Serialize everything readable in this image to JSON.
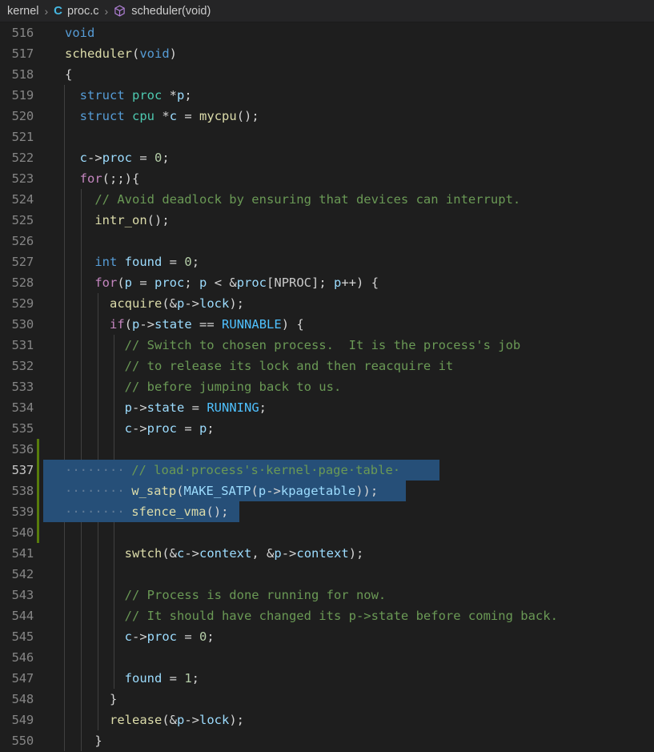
{
  "breadcrumb": {
    "name": "breadcrumb",
    "folder": "kernel",
    "separator": "›",
    "file": "proc.c",
    "file_icon_letter": "C",
    "file_icon_color": "#45b6e0",
    "symbol": "scheduler(void)",
    "symbol_icon": "cube-icon",
    "symbol_icon_color": "#b180d7"
  },
  "editor": {
    "language": "c",
    "first_line": 516,
    "active_line": 537,
    "theme": {
      "background": "#1e1e1e",
      "breadcrumb_background": "#252526",
      "selection": "#264f78",
      "gutter_added": "#587c0c",
      "line_number": "#858585",
      "line_number_active": "#c6c6c6",
      "indent_guide": "#404040",
      "keyword": "#c586c0",
      "type": "#569cd6",
      "typename": "#4ec9b0",
      "function": "#dcdcaa",
      "variable": "#9cdcfe",
      "constant": "#4fc1ff",
      "macro": "#c8c8c8",
      "number": "#b5cea8",
      "comment": "#6a9955",
      "plain": "#d4d4d4"
    },
    "lines": [
      {
        "n": 516,
        "text": "void",
        "indent": 0,
        "guides": 0,
        "changed": false,
        "selected": false,
        "tokens": [
          {
            "t": "void",
            "c": "t-type"
          }
        ]
      },
      {
        "n": 517,
        "text": "scheduler(void)",
        "indent": 0,
        "guides": 0,
        "changed": false,
        "selected": false,
        "tokens": [
          {
            "t": "scheduler",
            "c": "t-func"
          },
          {
            "t": "(",
            "c": "t-plain"
          },
          {
            "t": "void",
            "c": "t-type"
          },
          {
            "t": ")",
            "c": "t-plain"
          }
        ]
      },
      {
        "n": 518,
        "text": "{",
        "indent": 0,
        "guides": 0,
        "changed": false,
        "selected": false,
        "tokens": [
          {
            "t": "{",
            "c": "t-plain"
          }
        ]
      },
      {
        "n": 519,
        "text": "  struct proc *p;",
        "indent": 2,
        "guides": 1,
        "changed": false,
        "selected": false,
        "tokens": [
          {
            "t": "  ",
            "c": "t-plain"
          },
          {
            "t": "struct",
            "c": "t-type"
          },
          {
            "t": " ",
            "c": "t-plain"
          },
          {
            "t": "proc",
            "c": "t-typename"
          },
          {
            "t": " *",
            "c": "t-plain"
          },
          {
            "t": "p",
            "c": "t-var"
          },
          {
            "t": ";",
            "c": "t-plain"
          }
        ]
      },
      {
        "n": 520,
        "text": "  struct cpu *c = mycpu();",
        "indent": 2,
        "guides": 1,
        "changed": false,
        "selected": false,
        "tokens": [
          {
            "t": "  ",
            "c": "t-plain"
          },
          {
            "t": "struct",
            "c": "t-type"
          },
          {
            "t": " ",
            "c": "t-plain"
          },
          {
            "t": "cpu",
            "c": "t-typename"
          },
          {
            "t": " *",
            "c": "t-plain"
          },
          {
            "t": "c",
            "c": "t-var"
          },
          {
            "t": " = ",
            "c": "t-plain"
          },
          {
            "t": "mycpu",
            "c": "t-func"
          },
          {
            "t": "();",
            "c": "t-plain"
          }
        ]
      },
      {
        "n": 521,
        "text": "",
        "indent": 0,
        "guides": 1,
        "changed": false,
        "selected": false,
        "tokens": []
      },
      {
        "n": 522,
        "text": "  c->proc = 0;",
        "indent": 2,
        "guides": 1,
        "changed": false,
        "selected": false,
        "tokens": [
          {
            "t": "  ",
            "c": "t-plain"
          },
          {
            "t": "c",
            "c": "t-var"
          },
          {
            "t": "->",
            "c": "t-plain"
          },
          {
            "t": "proc",
            "c": "t-var"
          },
          {
            "t": " = ",
            "c": "t-plain"
          },
          {
            "t": "0",
            "c": "t-num"
          },
          {
            "t": ";",
            "c": "t-plain"
          }
        ]
      },
      {
        "n": 523,
        "text": "  for(;;){",
        "indent": 2,
        "guides": 1,
        "changed": false,
        "selected": false,
        "tokens": [
          {
            "t": "  ",
            "c": "t-plain"
          },
          {
            "t": "for",
            "c": "t-key"
          },
          {
            "t": "(;;){",
            "c": "t-plain"
          }
        ]
      },
      {
        "n": 524,
        "text": "    // Avoid deadlock by ensuring that devices can interrupt.",
        "indent": 4,
        "guides": 2,
        "changed": false,
        "selected": false,
        "tokens": [
          {
            "t": "    ",
            "c": "t-plain"
          },
          {
            "t": "// Avoid deadlock by ensuring that devices can interrupt.",
            "c": "t-cmt"
          }
        ]
      },
      {
        "n": 525,
        "text": "    intr_on();",
        "indent": 4,
        "guides": 2,
        "changed": false,
        "selected": false,
        "tokens": [
          {
            "t": "    ",
            "c": "t-plain"
          },
          {
            "t": "intr_on",
            "c": "t-func"
          },
          {
            "t": "();",
            "c": "t-plain"
          }
        ]
      },
      {
        "n": 526,
        "text": "",
        "indent": 0,
        "guides": 2,
        "changed": false,
        "selected": false,
        "tokens": []
      },
      {
        "n": 527,
        "text": "    int found = 0;",
        "indent": 4,
        "guides": 2,
        "changed": false,
        "selected": false,
        "tokens": [
          {
            "t": "    ",
            "c": "t-plain"
          },
          {
            "t": "int",
            "c": "t-type"
          },
          {
            "t": " ",
            "c": "t-plain"
          },
          {
            "t": "found",
            "c": "t-var"
          },
          {
            "t": " = ",
            "c": "t-plain"
          },
          {
            "t": "0",
            "c": "t-num"
          },
          {
            "t": ";",
            "c": "t-plain"
          }
        ]
      },
      {
        "n": 528,
        "text": "    for(p = proc; p < &proc[NPROC]; p++) {",
        "indent": 4,
        "guides": 2,
        "changed": false,
        "selected": false,
        "tokens": [
          {
            "t": "    ",
            "c": "t-plain"
          },
          {
            "t": "for",
            "c": "t-key"
          },
          {
            "t": "(",
            "c": "t-plain"
          },
          {
            "t": "p",
            "c": "t-var"
          },
          {
            "t": " = ",
            "c": "t-plain"
          },
          {
            "t": "proc",
            "c": "t-var"
          },
          {
            "t": "; ",
            "c": "t-plain"
          },
          {
            "t": "p",
            "c": "t-var"
          },
          {
            "t": " < &",
            "c": "t-plain"
          },
          {
            "t": "proc",
            "c": "t-var"
          },
          {
            "t": "[",
            "c": "t-plain"
          },
          {
            "t": "NPROC",
            "c": "t-macro"
          },
          {
            "t": "]; ",
            "c": "t-plain"
          },
          {
            "t": "p",
            "c": "t-var"
          },
          {
            "t": "++) {",
            "c": "t-plain"
          }
        ]
      },
      {
        "n": 529,
        "text": "      acquire(&p->lock);",
        "indent": 6,
        "guides": 3,
        "changed": false,
        "selected": false,
        "tokens": [
          {
            "t": "      ",
            "c": "t-plain"
          },
          {
            "t": "acquire",
            "c": "t-func"
          },
          {
            "t": "(&",
            "c": "t-plain"
          },
          {
            "t": "p",
            "c": "t-var"
          },
          {
            "t": "->",
            "c": "t-plain"
          },
          {
            "t": "lock",
            "c": "t-var"
          },
          {
            "t": ");",
            "c": "t-plain"
          }
        ]
      },
      {
        "n": 530,
        "text": "      if(p->state == RUNNABLE) {",
        "indent": 6,
        "guides": 3,
        "changed": false,
        "selected": false,
        "tokens": [
          {
            "t": "      ",
            "c": "t-plain"
          },
          {
            "t": "if",
            "c": "t-key"
          },
          {
            "t": "(",
            "c": "t-plain"
          },
          {
            "t": "p",
            "c": "t-var"
          },
          {
            "t": "->",
            "c": "t-plain"
          },
          {
            "t": "state",
            "c": "t-var"
          },
          {
            "t": " == ",
            "c": "t-plain"
          },
          {
            "t": "RUNNABLE",
            "c": "t-const"
          },
          {
            "t": ") {",
            "c": "t-plain"
          }
        ]
      },
      {
        "n": 531,
        "text": "        // Switch to chosen process.  It is the process's job",
        "indent": 8,
        "guides": 4,
        "changed": false,
        "selected": false,
        "tokens": [
          {
            "t": "        ",
            "c": "t-plain"
          },
          {
            "t": "// Switch to chosen process.  It is the process's job",
            "c": "t-cmt"
          }
        ]
      },
      {
        "n": 532,
        "text": "        // to release its lock and then reacquire it",
        "indent": 8,
        "guides": 4,
        "changed": false,
        "selected": false,
        "tokens": [
          {
            "t": "        ",
            "c": "t-plain"
          },
          {
            "t": "// to release its lock and then reacquire it",
            "c": "t-cmt"
          }
        ]
      },
      {
        "n": 533,
        "text": "        // before jumping back to us.",
        "indent": 8,
        "guides": 4,
        "changed": false,
        "selected": false,
        "tokens": [
          {
            "t": "        ",
            "c": "t-plain"
          },
          {
            "t": "// before jumping back to us.",
            "c": "t-cmt"
          }
        ]
      },
      {
        "n": 534,
        "text": "        p->state = RUNNING;",
        "indent": 8,
        "guides": 4,
        "changed": false,
        "selected": false,
        "tokens": [
          {
            "t": "        ",
            "c": "t-plain"
          },
          {
            "t": "p",
            "c": "t-var"
          },
          {
            "t": "->",
            "c": "t-plain"
          },
          {
            "t": "state",
            "c": "t-var"
          },
          {
            "t": " = ",
            "c": "t-plain"
          },
          {
            "t": "RUNNING",
            "c": "t-const"
          },
          {
            "t": ";",
            "c": "t-plain"
          }
        ]
      },
      {
        "n": 535,
        "text": "        c->proc = p;",
        "indent": 8,
        "guides": 4,
        "changed": false,
        "selected": false,
        "tokens": [
          {
            "t": "        ",
            "c": "t-plain"
          },
          {
            "t": "c",
            "c": "t-var"
          },
          {
            "t": "->",
            "c": "t-plain"
          },
          {
            "t": "proc",
            "c": "t-var"
          },
          {
            "t": " = ",
            "c": "t-plain"
          },
          {
            "t": "p",
            "c": "t-var"
          },
          {
            "t": ";",
            "c": "t-plain"
          }
        ]
      },
      {
        "n": 536,
        "text": "",
        "indent": 0,
        "guides": 4,
        "changed": true,
        "selected": false,
        "tokens": []
      },
      {
        "n": 537,
        "text": "        // load process's kernel page table ",
        "indent": 8,
        "guides": 4,
        "changed": true,
        "selected": true,
        "sel_cols": 45,
        "ws_dots": 8,
        "tokens": [
          {
            "t": "// load·process's·kernel·page·table·",
            "c": "t-cmt"
          }
        ]
      },
      {
        "n": 538,
        "text": "        w_satp(MAKE_SATP(p->kpagetable));",
        "indent": 8,
        "guides": 4,
        "changed": true,
        "selected": true,
        "sel_cols": 41,
        "ws_dots": 8,
        "tokens": [
          {
            "t": "w_satp",
            "c": "t-func"
          },
          {
            "t": "(",
            "c": "t-plain"
          },
          {
            "t": "MAKE_SATP",
            "c": "t-var"
          },
          {
            "t": "(",
            "c": "t-plain"
          },
          {
            "t": "p",
            "c": "t-var"
          },
          {
            "t": "->",
            "c": "t-plain"
          },
          {
            "t": "kpagetable",
            "c": "t-var"
          },
          {
            "t": "));",
            "c": "t-plain"
          }
        ]
      },
      {
        "n": 539,
        "text": "        sfence_vma();",
        "indent": 8,
        "guides": 4,
        "changed": true,
        "selected": true,
        "sel_cols": 21,
        "ws_dots": 8,
        "tokens": [
          {
            "t": "sfence_vma",
            "c": "t-func"
          },
          {
            "t": "();",
            "c": "t-plain"
          }
        ]
      },
      {
        "n": 540,
        "text": "",
        "indent": 0,
        "guides": 4,
        "changed": true,
        "selected": false,
        "tokens": []
      },
      {
        "n": 541,
        "text": "        swtch(&c->context, &p->context);",
        "indent": 8,
        "guides": 4,
        "changed": false,
        "selected": false,
        "tokens": [
          {
            "t": "        ",
            "c": "t-plain"
          },
          {
            "t": "swtch",
            "c": "t-func"
          },
          {
            "t": "(&",
            "c": "t-plain"
          },
          {
            "t": "c",
            "c": "t-var"
          },
          {
            "t": "->",
            "c": "t-plain"
          },
          {
            "t": "context",
            "c": "t-var"
          },
          {
            "t": ", &",
            "c": "t-plain"
          },
          {
            "t": "p",
            "c": "t-var"
          },
          {
            "t": "->",
            "c": "t-plain"
          },
          {
            "t": "context",
            "c": "t-var"
          },
          {
            "t": ");",
            "c": "t-plain"
          }
        ]
      },
      {
        "n": 542,
        "text": "",
        "indent": 0,
        "guides": 4,
        "changed": false,
        "selected": false,
        "tokens": []
      },
      {
        "n": 543,
        "text": "        // Process is done running for now.",
        "indent": 8,
        "guides": 4,
        "changed": false,
        "selected": false,
        "tokens": [
          {
            "t": "        ",
            "c": "t-plain"
          },
          {
            "t": "// Process is done running for now.",
            "c": "t-cmt"
          }
        ]
      },
      {
        "n": 544,
        "text": "        // It should have changed its p->state before coming back.",
        "indent": 8,
        "guides": 4,
        "changed": false,
        "selected": false,
        "tokens": [
          {
            "t": "        ",
            "c": "t-plain"
          },
          {
            "t": "// It should have changed its p->state before coming back.",
            "c": "t-cmt"
          }
        ]
      },
      {
        "n": 545,
        "text": "        c->proc = 0;",
        "indent": 8,
        "guides": 4,
        "changed": false,
        "selected": false,
        "tokens": [
          {
            "t": "        ",
            "c": "t-plain"
          },
          {
            "t": "c",
            "c": "t-var"
          },
          {
            "t": "->",
            "c": "t-plain"
          },
          {
            "t": "proc",
            "c": "t-var"
          },
          {
            "t": " = ",
            "c": "t-plain"
          },
          {
            "t": "0",
            "c": "t-num"
          },
          {
            "t": ";",
            "c": "t-plain"
          }
        ]
      },
      {
        "n": 546,
        "text": "",
        "indent": 0,
        "guides": 4,
        "changed": false,
        "selected": false,
        "tokens": []
      },
      {
        "n": 547,
        "text": "        found = 1;",
        "indent": 8,
        "guides": 4,
        "changed": false,
        "selected": false,
        "tokens": [
          {
            "t": "        ",
            "c": "t-plain"
          },
          {
            "t": "found",
            "c": "t-var"
          },
          {
            "t": " = ",
            "c": "t-plain"
          },
          {
            "t": "1",
            "c": "t-num"
          },
          {
            "t": ";",
            "c": "t-plain"
          }
        ]
      },
      {
        "n": 548,
        "text": "      }",
        "indent": 6,
        "guides": 3,
        "changed": false,
        "selected": false,
        "tokens": [
          {
            "t": "      }",
            "c": "t-plain"
          }
        ]
      },
      {
        "n": 549,
        "text": "      release(&p->lock);",
        "indent": 6,
        "guides": 3,
        "changed": false,
        "selected": false,
        "tokens": [
          {
            "t": "      ",
            "c": "t-plain"
          },
          {
            "t": "release",
            "c": "t-func"
          },
          {
            "t": "(&",
            "c": "t-plain"
          },
          {
            "t": "p",
            "c": "t-var"
          },
          {
            "t": "->",
            "c": "t-plain"
          },
          {
            "t": "lock",
            "c": "t-var"
          },
          {
            "t": ");",
            "c": "t-plain"
          }
        ]
      },
      {
        "n": 550,
        "text": "    }",
        "indent": 4,
        "guides": 2,
        "changed": false,
        "selected": false,
        "tokens": [
          {
            "t": "    }",
            "c": "t-plain"
          }
        ]
      }
    ]
  }
}
